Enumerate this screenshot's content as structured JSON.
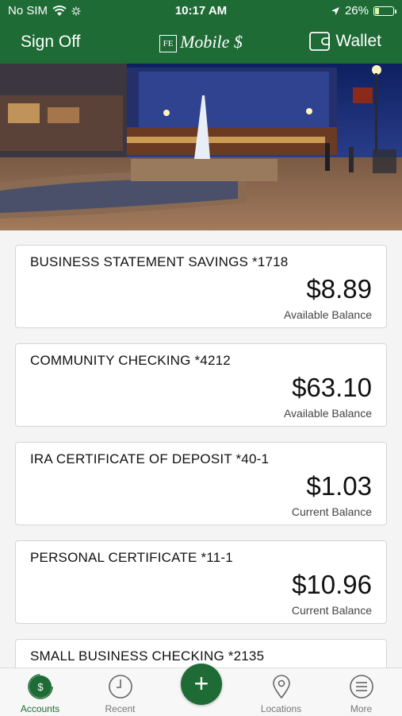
{
  "status_bar": {
    "carrier": "No SIM",
    "time": "10:17 AM",
    "battery": "26%",
    "battery_level": 0.26
  },
  "header": {
    "sign_off": "Sign Off",
    "logo_text": "Mobile $",
    "logo_mark": "FE",
    "wallet": "Wallet"
  },
  "accounts": [
    {
      "name": "BUSINESS STATEMENT SAVINGS *1718",
      "amount": "$8.89",
      "label": "Available Balance"
    },
    {
      "name": "COMMUNITY CHECKING *4212",
      "amount": "$63.10",
      "label": "Available Balance"
    },
    {
      "name": "IRA CERTIFICATE OF DEPOSIT *40-1",
      "amount": "$1.03",
      "label": "Current Balance"
    },
    {
      "name": "PERSONAL CERTIFICATE *11-1",
      "amount": "$10.96",
      "label": "Current Balance"
    },
    {
      "name": "SMALL BUSINESS CHECKING *2135",
      "amount": "",
      "label": ""
    }
  ],
  "tabs": [
    {
      "label": "Accounts",
      "icon": "dollar-icon",
      "active": true
    },
    {
      "label": "Recent",
      "icon": "clock-icon"
    },
    {
      "label": "Locations",
      "icon": "map-pin-icon"
    },
    {
      "label": "More",
      "icon": "menu-icon"
    }
  ],
  "fab": {
    "label": "+"
  },
  "colors": {
    "brand": "#1e6b36",
    "tab_inactive": "#777777"
  }
}
